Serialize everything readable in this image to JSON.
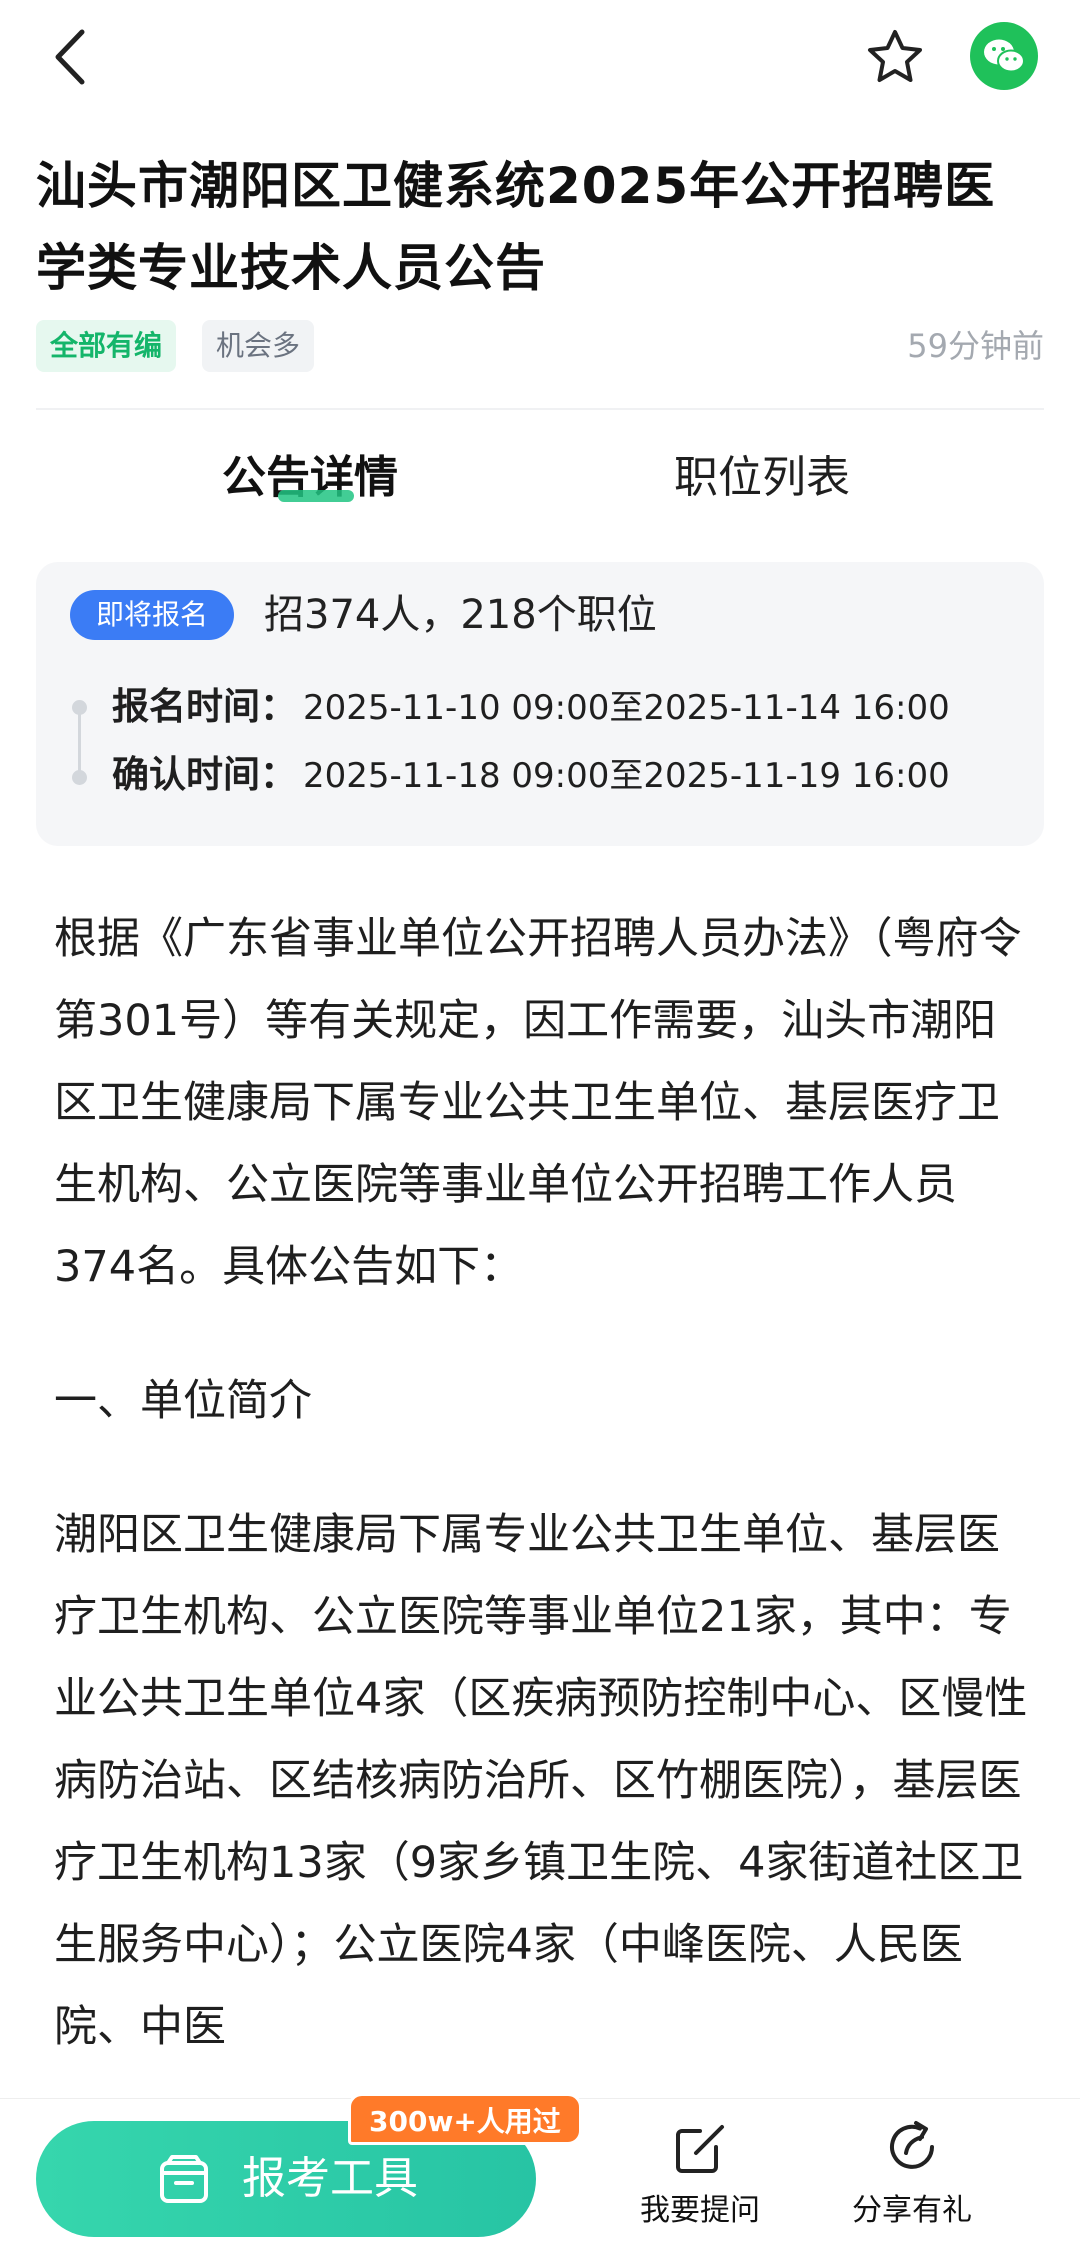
{
  "icons": {
    "back": "chevron-left-icon",
    "favorite": "star-icon",
    "share_wechat": "wechat-icon",
    "tool": "box-icon",
    "ask": "edit-icon",
    "gift_share": "share-arrow-icon"
  },
  "colors": {
    "accent_green": "#21c483",
    "badge_blue": "#3b7cf5",
    "badge_orange": "#ff7a29",
    "wechat_green": "#1fc15a"
  },
  "header": {
    "title": "汕头市潮阳区卫健系统2025年公开招聘医学类专业技术人员公告"
  },
  "meta": {
    "tags": [
      "全部有编",
      "机会多"
    ],
    "time": "59分钟前"
  },
  "tabs": [
    {
      "label": "公告详情",
      "active": true
    },
    {
      "label": "职位列表",
      "active": false
    }
  ],
  "info": {
    "badge": "即将报名",
    "summary": "招374人，218个职位",
    "rows": [
      {
        "label": "报名时间：",
        "value": "2025-11-10 09:00至2025-11-14 16:00"
      },
      {
        "label": "确认时间：",
        "value": "2025-11-18 09:00至2025-11-19 16:00"
      }
    ]
  },
  "article": {
    "paragraphs": [
      "根据《广东省事业单位公开招聘人员办法》（粤府令第301号）等有关规定，因工作需要，汕头市潮阳区卫生健康局下属专业公共卫生单位、基层医疗卫生机构、公立医院等事业单位公开招聘工作人员374名。具体公告如下：",
      "一、单位简介",
      "潮阳区卫生健康局下属专业公共卫生单位、基层医疗卫生机构、公立医院等事业单位21家，其中：专业公共卫生单位4家（区疾病预防控制中心、区慢性病防治站、区结核病防治所、区竹棚医院），基层医疗卫生机构13家（9家乡镇卫生院、4家街道社区卫生服务中心）；公立医院4家（中峰医院、人民医院、中医"
    ]
  },
  "bottom": {
    "tool_label": "报考工具",
    "tool_badge": "300w+人用过",
    "ask_label": "我要提问",
    "share_label": "分享有礼"
  }
}
